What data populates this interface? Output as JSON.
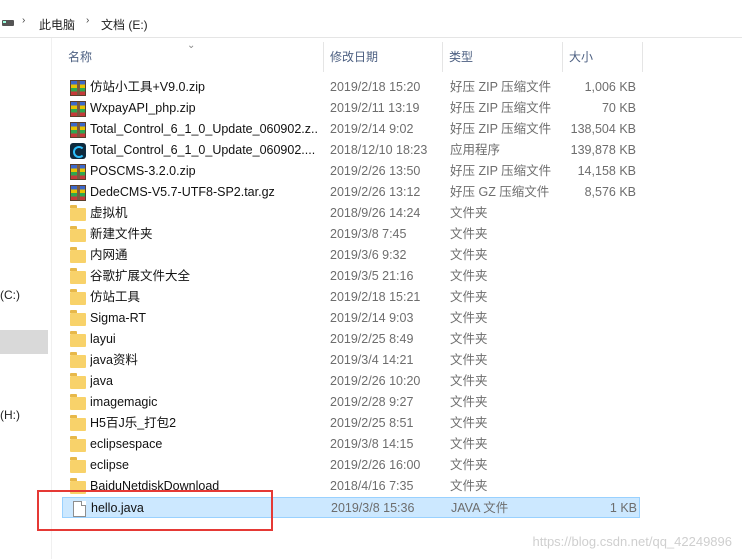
{
  "breadcrumb": {
    "items": [
      "此电脑",
      "文档 (E:)"
    ]
  },
  "navpane": {
    "items": [
      "(C:)",
      "(H:)"
    ]
  },
  "columns": {
    "name": "名称",
    "date": "修改日期",
    "type": "类型",
    "size": "大小"
  },
  "files": [
    {
      "name": "仿站小工具+V9.0.zip",
      "date": "2019/2/18 15:20",
      "type": "好压 ZIP 压缩文件",
      "size": "1,006 KB",
      "icon": "zip-archive-icon"
    },
    {
      "name": "WxpayAPI_php.zip",
      "date": "2019/2/11 13:19",
      "type": "好压 ZIP 压缩文件",
      "size": "70 KB",
      "icon": "zip-archive-icon"
    },
    {
      "name": "Total_Control_6_1_0_Update_060902.z...",
      "date": "2019/2/14 9:02",
      "type": "好压 ZIP 压缩文件",
      "size": "138,504 KB",
      "icon": "zip-archive-icon"
    },
    {
      "name": "Total_Control_6_1_0_Update_060902....",
      "date": "2018/12/10 18:23",
      "type": "应用程序",
      "size": "139,878 KB",
      "icon": "application-icon"
    },
    {
      "name": "POSCMS-3.2.0.zip",
      "date": "2019/2/26 13:50",
      "type": "好压 ZIP 压缩文件",
      "size": "14,158 KB",
      "icon": "zip-archive-icon"
    },
    {
      "name": "DedeCMS-V5.7-UTF8-SP2.tar.gz",
      "date": "2019/2/26 13:12",
      "type": "好压 GZ 压缩文件",
      "size": "8,576 KB",
      "icon": "zip-archive-icon"
    },
    {
      "name": "虚拟机",
      "date": "2018/9/26 14:24",
      "type": "文件夹",
      "size": "",
      "icon": "folder-icon"
    },
    {
      "name": "新建文件夹",
      "date": "2019/3/8 7:45",
      "type": "文件夹",
      "size": "",
      "icon": "folder-icon"
    },
    {
      "name": "内网通",
      "date": "2019/3/6 9:32",
      "type": "文件夹",
      "size": "",
      "icon": "folder-icon"
    },
    {
      "name": "谷歌扩展文件大全",
      "date": "2019/3/5 21:16",
      "type": "文件夹",
      "size": "",
      "icon": "folder-icon"
    },
    {
      "name": "仿站工具",
      "date": "2019/2/18 15:21",
      "type": "文件夹",
      "size": "",
      "icon": "folder-icon"
    },
    {
      "name": "Sigma-RT",
      "date": "2019/2/14 9:03",
      "type": "文件夹",
      "size": "",
      "icon": "folder-icon"
    },
    {
      "name": "layui",
      "date": "2019/2/25 8:49",
      "type": "文件夹",
      "size": "",
      "icon": "folder-icon"
    },
    {
      "name": "java资料",
      "date": "2019/3/4 14:21",
      "type": "文件夹",
      "size": "",
      "icon": "folder-icon"
    },
    {
      "name": "java",
      "date": "2019/2/26 10:20",
      "type": "文件夹",
      "size": "",
      "icon": "folder-icon"
    },
    {
      "name": "imagemagic",
      "date": "2019/2/28 9:27",
      "type": "文件夹",
      "size": "",
      "icon": "folder-icon"
    },
    {
      "name": "H5百J乐_打包2",
      "date": "2019/2/25 8:51",
      "type": "文件夹",
      "size": "",
      "icon": "folder-icon"
    },
    {
      "name": "eclipsespace",
      "date": "2019/3/8 14:15",
      "type": "文件夹",
      "size": "",
      "icon": "folder-icon"
    },
    {
      "name": "eclipse",
      "date": "2019/2/26 16:00",
      "type": "文件夹",
      "size": "",
      "icon": "folder-icon"
    },
    {
      "name": "BaiduNetdiskDownload",
      "date": "2018/4/16 7:35",
      "type": "文件夹",
      "size": "",
      "icon": "folder-icon"
    },
    {
      "name": "hello.java",
      "date": "2019/3/8 15:36",
      "type": "JAVA 文件",
      "size": "1 KB",
      "icon": "java-file-icon",
      "selected": true
    }
  ],
  "watermark": "https://blog.csdn.net/qq_42249896",
  "colors": {
    "selection_bg": "#cce8ff",
    "selection_border": "#99d1ff",
    "annotation": "#e53935",
    "header_text": "#4d6082"
  }
}
